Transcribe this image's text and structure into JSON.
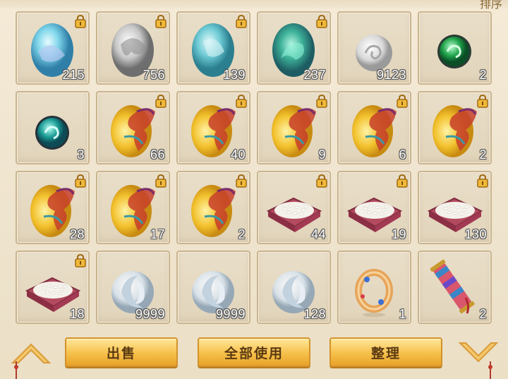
{
  "header": {
    "label": "排序"
  },
  "inventory": {
    "slots": [
      {
        "icon": "ice-egg-icon",
        "count": "215",
        "locked": true
      },
      {
        "icon": "silver-egg-icon",
        "count": "756",
        "locked": true
      },
      {
        "icon": "teal-egg-icon",
        "count": "139",
        "locked": true
      },
      {
        "icon": "jade-egg-icon",
        "count": "237",
        "locked": true
      },
      {
        "icon": "silver-orb-icon",
        "count": "9123",
        "locked": false
      },
      {
        "icon": "green-orb-icon",
        "count": "2",
        "locked": false
      },
      {
        "icon": "teal-orb-icon",
        "count": "3",
        "locked": false
      },
      {
        "icon": "dragon-egg-icon",
        "count": "66",
        "locked": true
      },
      {
        "icon": "dragon-egg-icon",
        "count": "40",
        "locked": true
      },
      {
        "icon": "dragon-egg-icon",
        "count": "9",
        "locked": true
      },
      {
        "icon": "dragon-egg-icon",
        "count": "6",
        "locked": true
      },
      {
        "icon": "dragon-egg-icon",
        "count": "2",
        "locked": true
      },
      {
        "icon": "dragon-egg-icon",
        "count": "28",
        "locked": true
      },
      {
        "icon": "dragon-egg-icon",
        "count": "17",
        "locked": true
      },
      {
        "icon": "dragon-egg-icon",
        "count": "2",
        "locked": true
      },
      {
        "icon": "rice-tray-icon",
        "count": "44",
        "locked": true
      },
      {
        "icon": "rice-tray-icon",
        "count": "19",
        "locked": true
      },
      {
        "icon": "rice-tray-icon",
        "count": "130",
        "locked": true
      },
      {
        "icon": "rice-tray-icon",
        "count": "18",
        "locked": true
      },
      {
        "icon": "crescent-orb-icon",
        "count": "9999",
        "locked": false
      },
      {
        "icon": "crescent-orb-icon",
        "count": "9999",
        "locked": false
      },
      {
        "icon": "crescent-orb-icon",
        "count": "128",
        "locked": false
      },
      {
        "icon": "ring-icon",
        "count": "1",
        "locked": false
      },
      {
        "icon": "scroll-icon",
        "count": "2",
        "locked": false
      }
    ]
  },
  "actions": {
    "sell": "出售",
    "use_all": "全部使用",
    "sort": "整理"
  },
  "nav": {
    "up": "arrow-up-icon",
    "down": "arrow-down-icon"
  }
}
